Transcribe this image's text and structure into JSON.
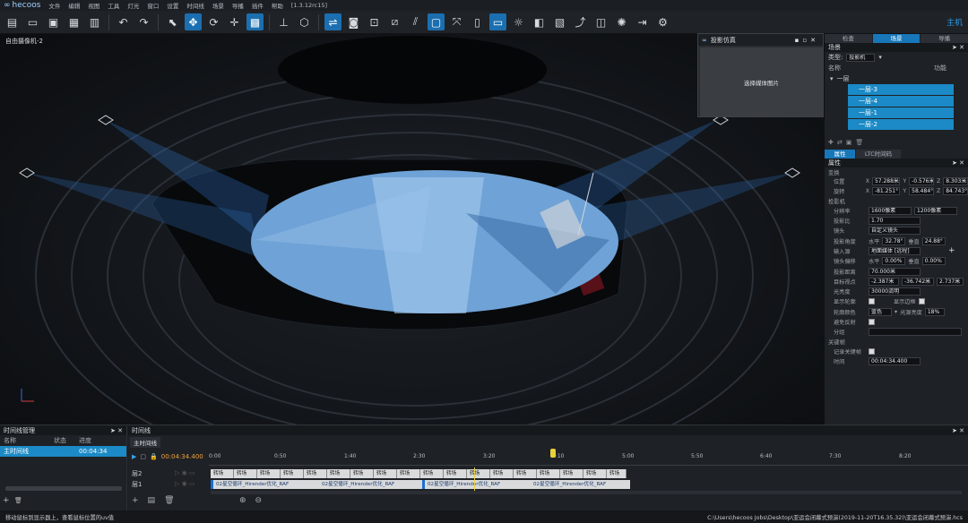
{
  "menubar": {
    "app_name": "hecoos",
    "items": [
      "文件",
      "编辑",
      "视图",
      "工具",
      "灯光",
      "窗口",
      "设置",
      "时间线",
      "场景",
      "导播",
      "插件",
      "帮助"
    ],
    "version": "[1.3.12rc15]"
  },
  "toolbar": {
    "icons": [
      "new-icon",
      "open-icon",
      "save-icon",
      "save-as-icon",
      "library-icon",
      "undo-icon",
      "redo-icon",
      "select-icon",
      "move-icon",
      "rotate-icon",
      "scale-icon",
      "snap-icon",
      "align-icon",
      "cube-icon",
      "view-icon",
      "camera-icon",
      "focus-icon",
      "grid-icon",
      "measure-icon",
      "frame-icon",
      "transform-icon",
      "screen-icon",
      "light-icon",
      "render-icon",
      "media-icon",
      "share-icon",
      "device-icon",
      "brightness-icon",
      "exit-icon",
      "settings-icon"
    ],
    "right_label": "主机"
  },
  "viewport": {
    "label": "自由摄像机-2"
  },
  "projector_panel": {
    "title": "投影仿真",
    "message": "选择媒体图片"
  },
  "right_panel": {
    "tabs": [
      "检查",
      "场景",
      "导播"
    ],
    "scene_header": "场景",
    "type_label": "类型:",
    "type_value": "投影机",
    "col_name": "名称",
    "col_func": "功能",
    "group_name": "一层",
    "items": [
      "一层-3",
      "一层-4",
      "一层-1",
      "一层-2"
    ],
    "bottom_tabs": [
      "属性",
      "LTC时间码"
    ],
    "props_header": "属性",
    "groups": {
      "transform": "变换",
      "projector": "投影机",
      "keyframe": "关键帧"
    },
    "position": {
      "label": "位置",
      "x": "57.288米",
      "y": "-0.576米",
      "z": "8.303米"
    },
    "rotation": {
      "label": "旋转",
      "x": "-81.251°",
      "y": "58.484°",
      "z": "84.743°"
    },
    "resolution": {
      "label": "分辨率",
      "w": "1600像素",
      "h": "1200像素"
    },
    "aspect": {
      "label": "投影比",
      "value": "1.70"
    },
    "lens": {
      "label": "镜头",
      "value": "自定义镜头"
    },
    "fov": {
      "label": "投影角度",
      "h_label": "水平",
      "h": "32.78°",
      "v_label": "垂直",
      "v": "24.88°"
    },
    "input": {
      "label": "输入源",
      "value": "地面媒体 [远程]"
    },
    "shift": {
      "label": "镜头偏移",
      "h_label": "水平",
      "h": "0.00%",
      "v_label": "垂直",
      "v": "0.00%"
    },
    "distance": {
      "label": "投影距离",
      "value": "70.000米"
    },
    "target": {
      "label": "目标视点",
      "x": "-2.387米",
      "y": "-36.742米",
      "z": "2.737米"
    },
    "brightness": {
      "label": "光亮度",
      "value": "30000流明"
    },
    "show_outline": {
      "label": "显示轮廓",
      "label2": "显示边框"
    },
    "outline_color": {
      "label": "轮廓颜色",
      "value": "蓝色",
      "label2": "光源亮度",
      "value2": "18%"
    },
    "effect": {
      "label": "避免反射"
    },
    "group": {
      "label": "分组",
      "value": ""
    },
    "record_keyframe": {
      "label": "记录关键帧"
    },
    "time": {
      "label": "时间",
      "value": "00:04:34.400"
    }
  },
  "timeline_manager": {
    "title": "时间线管理",
    "col_name": "名称",
    "col_state": "状态",
    "col_progress": "进度",
    "row_name": "主时间线",
    "row_progress": "00:04:34"
  },
  "timeline": {
    "title": "时间线",
    "tab": "主时间线",
    "current_time": "00:04:34.400",
    "ticks": [
      "0:00",
      "0:50",
      "1:40",
      "2:30",
      "3:20",
      "4:10",
      "5:00",
      "5:50",
      "6:40",
      "7:30",
      "8:20"
    ],
    "layers": [
      "层2",
      "层1"
    ],
    "transition_label": "转场",
    "clip_label": "02星空循环_Hirender优化_RAF"
  },
  "status": {
    "left": "移动鼠标到显示器上，查看鼠标位置的uv值",
    "right": "C:\\Users\\hecoos Jobs\\Desktop\\亚运会闭幕式预演(2019-11-20T16.35.32)\\亚运会闭幕式预演.hcs"
  }
}
